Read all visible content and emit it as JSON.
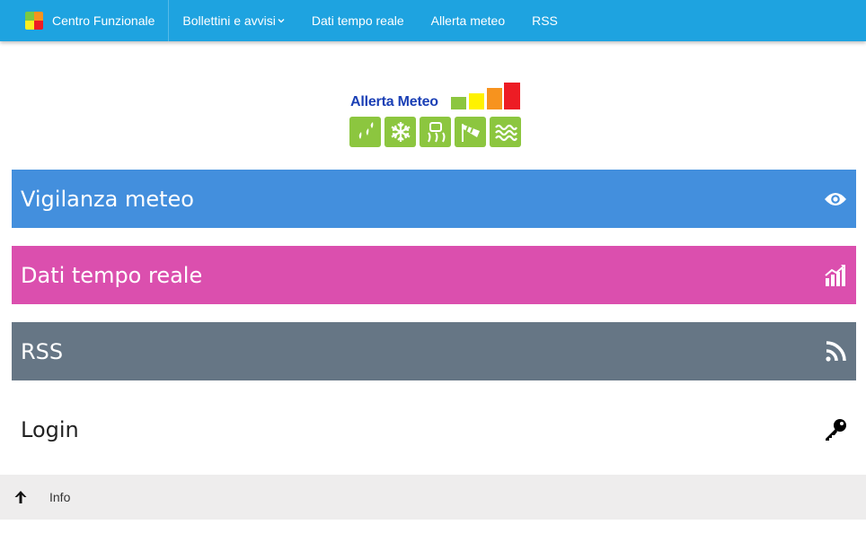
{
  "navbar": {
    "brand": "Centro Funzionale",
    "items": [
      {
        "label": "Bollettini e avvisi",
        "has_dropdown": true
      },
      {
        "label": "Dati tempo reale"
      },
      {
        "label": "Allerta meteo"
      },
      {
        "label": "RSS"
      }
    ]
  },
  "logo": {
    "title": "Allerta Meteo",
    "bar_colors": [
      "#8cc63f",
      "#fff200",
      "#f7931e",
      "#ed1c24"
    ],
    "tiles": [
      "rain-icon",
      "snowflake-icon",
      "ice-road-icon",
      "windsock-icon",
      "waves-icon"
    ]
  },
  "panels": [
    {
      "label": "Vigilanza meteo",
      "icon": "eye-icon",
      "color": "#438fdd"
    },
    {
      "label": "Dati tempo reale",
      "icon": "bar-chart-icon",
      "color": "#db4fae"
    },
    {
      "label": "RSS",
      "icon": "rss-icon",
      "color": "#667685"
    },
    {
      "label": "Login",
      "icon": "key-icon",
      "color": "#ffffff"
    }
  ],
  "footer": {
    "info_label": "Info",
    "icon": "arrow-up-icon"
  }
}
